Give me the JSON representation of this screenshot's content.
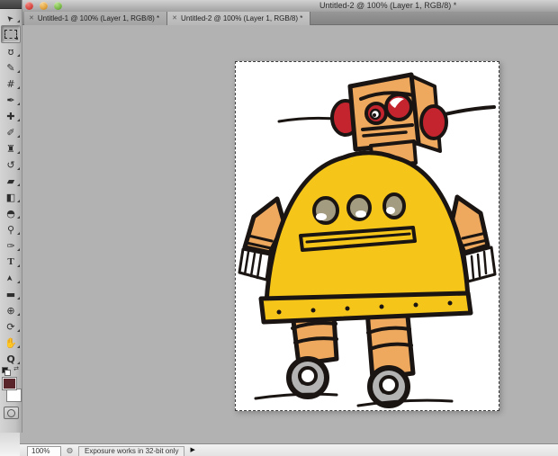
{
  "window": {
    "title": "Untitled-2 @ 100% (Layer 1, RGB/8) *",
    "close_glyph": "✕"
  },
  "tabs": [
    {
      "label": "Untitled-1 @ 100% (Layer 1, RGB/8) *",
      "active": false
    },
    {
      "label": "Untitled-2 @ 100% (Layer 1, RGB/8) *",
      "active": true
    }
  ],
  "toolbar": {
    "tools": [
      {
        "name": "move",
        "glyph": "➤",
        "selected": false
      },
      {
        "name": "rectangular-marquee",
        "glyph": "",
        "selected": true
      },
      {
        "name": "lasso",
        "glyph": "ʊ",
        "selected": false
      },
      {
        "name": "quick-selection",
        "glyph": "✎",
        "selected": false
      },
      {
        "name": "crop",
        "glyph": "#",
        "selected": false
      },
      {
        "name": "eyedropper",
        "glyph": "✒",
        "selected": false
      },
      {
        "name": "spot-healing-brush",
        "glyph": "✚",
        "selected": false
      },
      {
        "name": "brush",
        "glyph": "✐",
        "selected": false
      },
      {
        "name": "clone-stamp",
        "glyph": "♜",
        "selected": false
      },
      {
        "name": "history-brush",
        "glyph": "↺",
        "selected": false
      },
      {
        "name": "eraser",
        "glyph": "▰",
        "selected": false
      },
      {
        "name": "gradient",
        "glyph": "◧",
        "selected": false
      },
      {
        "name": "blur",
        "glyph": "◓",
        "selected": false
      },
      {
        "name": "dodge",
        "glyph": "⚲",
        "selected": false
      },
      {
        "name": "pen",
        "glyph": "✑",
        "selected": false
      },
      {
        "name": "type",
        "glyph": "T",
        "selected": false
      },
      {
        "name": "path-selection",
        "glyph": "➤",
        "selected": false
      },
      {
        "name": "rectangle-shape",
        "glyph": "▬",
        "selected": false
      },
      {
        "name": "3d-rotate",
        "glyph": "⊕",
        "selected": false
      },
      {
        "name": "3d-orbit",
        "glyph": "⟳",
        "selected": false
      },
      {
        "name": "hand",
        "glyph": "✋",
        "selected": false
      },
      {
        "name": "zoom",
        "glyph": "Q",
        "selected": false
      }
    ],
    "swap_colors_glyph": "⇄"
  },
  "statusbar": {
    "zoom_level": "100%",
    "status_icon_glyph": "◍",
    "message": "Exposure works in 32-bit only",
    "arrow_glyph": "▶"
  },
  "canvas": {
    "artwork": "hand-drawn cartoon robot with square head, red ears and eyes, antennae, large yellow bell-shaped body with three gray buttons and a slot, tan arms with fringed hands, tan banded legs on gray wheels",
    "selection": "marching-ants around full canvas"
  },
  "colors": {
    "robot-yellow": "#f6c51a",
    "robot-tan": "#efa95e",
    "robot-red": "#c4242e",
    "robot-button-gray": "#a39c80",
    "robot-wheel-gray": "#b3b3b3",
    "robot-outline": "#1a1512",
    "foreground-swatch": "#5b262b",
    "background-swatch": "#ffffff",
    "pasteboard": "#b2b2b2"
  }
}
